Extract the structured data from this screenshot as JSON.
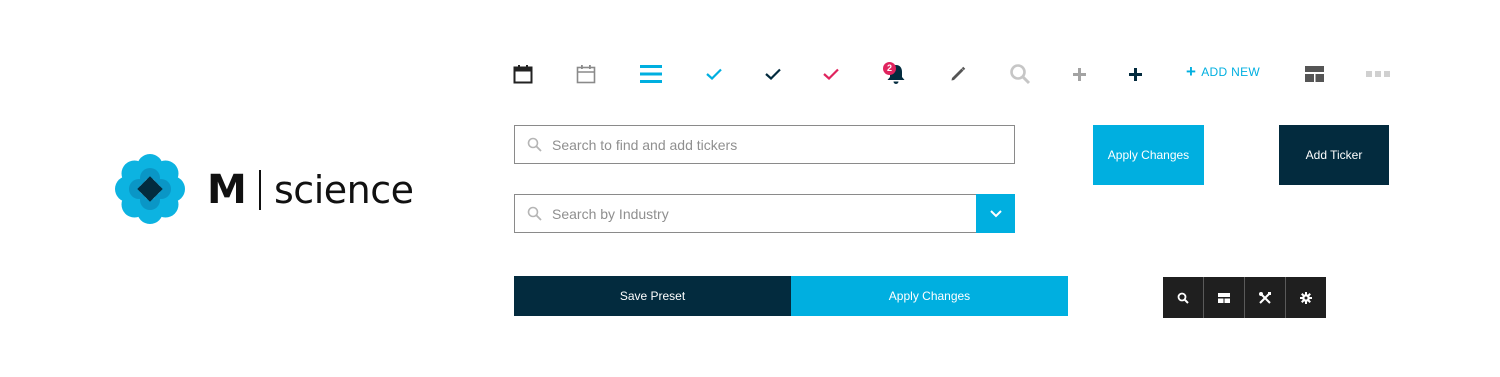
{
  "brand": {
    "name_letter": "M",
    "name_word": "science",
    "colors": {
      "cyan": "#00afe0",
      "navy": "#032b3e",
      "pink": "#e0245e",
      "dark": "#1f1f1f"
    }
  },
  "icons": {
    "row": [
      "calendar-icon",
      "calendar-outline-icon",
      "menu-icon",
      "check-cyan-icon",
      "check-navy-icon",
      "check-pink-icon",
      "bell-icon",
      "pencil-icon",
      "search-icon",
      "plus-gray-icon",
      "plus-navy-icon",
      "add-new-plus-icon",
      "layout-icon",
      "more-icon"
    ]
  },
  "notifications": {
    "count": "2"
  },
  "add_new": {
    "label": "ADD NEW"
  },
  "search_tickers": {
    "placeholder": "Search to find and add tickers"
  },
  "search_industry": {
    "placeholder": "Search by Industry"
  },
  "buttons": {
    "apply_changes_top": "Apply Changes",
    "add_ticker": "Add Ticker",
    "save_preset": "Save Preset",
    "apply_changes_bottom": "Apply Changes"
  },
  "toolbar": {
    "items": [
      "search-icon",
      "layout-icon",
      "tools-icon",
      "gear-icon"
    ]
  }
}
